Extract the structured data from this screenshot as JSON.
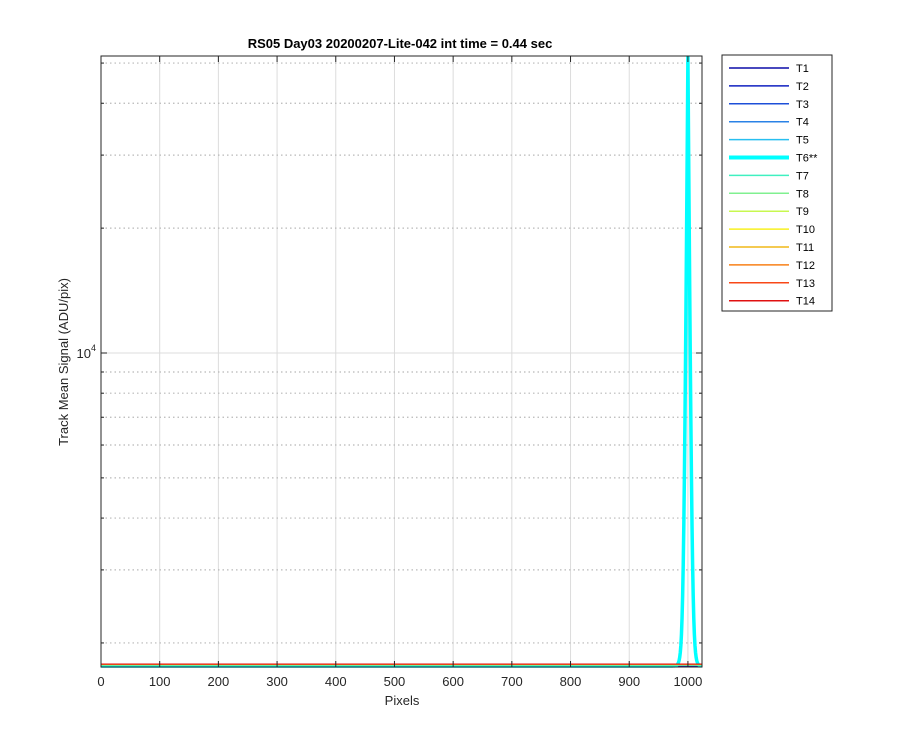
{
  "chart_data": {
    "type": "line",
    "title": "RS05 Day03 20200207-Lite-042 int time = 0.44 sec",
    "xlabel": "Pixels",
    "ylabel": "Track Mean Signal (ADU/pix)",
    "xlim": [
      0,
      1024
    ],
    "ylim": [
      1750,
      52000
    ],
    "yscale": "log",
    "grid": true,
    "legend_position": "outside-right",
    "x_ticks": [
      0,
      100,
      200,
      300,
      400,
      500,
      600,
      700,
      800,
      900,
      1000
    ],
    "x_tick_labels": [
      "0",
      "100",
      "200",
      "300",
      "400",
      "500",
      "600",
      "700",
      "800",
      "900",
      "1000"
    ],
    "y_major_ticks": [
      10000
    ],
    "y_tick_label": {
      "base": "10",
      "exponent": "4"
    },
    "y_minor_ticks": [
      2000,
      3000,
      4000,
      5000,
      6000,
      7000,
      8000,
      9000,
      20000,
      30000,
      40000,
      50000
    ],
    "baseline_value": 1760,
    "peak_x": 1000,
    "peak_value": 52000,
    "series": [
      {
        "name": "T1",
        "color": "#0b0ba8",
        "highlight": false
      },
      {
        "name": "T2",
        "color": "#1020c0",
        "highlight": false
      },
      {
        "name": "T3",
        "color": "#1d4fd8",
        "highlight": false
      },
      {
        "name": "T4",
        "color": "#2a82e6",
        "highlight": false
      },
      {
        "name": "T5",
        "color": "#28bff0",
        "highlight": false
      },
      {
        "name": "T6**",
        "color": "#00ffff",
        "highlight": true
      },
      {
        "name": "T7",
        "color": "#40f0c0",
        "highlight": false
      },
      {
        "name": "T8",
        "color": "#80f090",
        "highlight": false
      },
      {
        "name": "T9",
        "color": "#c8f850",
        "highlight": false
      },
      {
        "name": "T10",
        "color": "#f8f020",
        "highlight": false
      },
      {
        "name": "T11",
        "color": "#f0b818",
        "highlight": false
      },
      {
        "name": "T12",
        "color": "#f88018",
        "highlight": false
      },
      {
        "name": "T13",
        "color": "#f84818",
        "highlight": false
      },
      {
        "name": "T14",
        "color": "#e01010",
        "highlight": false
      }
    ]
  }
}
